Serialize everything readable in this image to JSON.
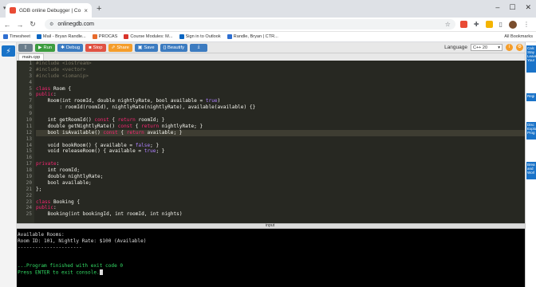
{
  "browser": {
    "tab_title": "GDB online Debugger | Compi...",
    "url": "onlinegdb.com",
    "bookmarks": [
      {
        "label": "Timesheet",
        "color": "#2f6fd1"
      },
      {
        "label": "Mail - Bryan Randle...",
        "color": "#0a66c2"
      },
      {
        "label": "PROCAS",
        "color": "#e86b2d"
      },
      {
        "label": "Course Modules: M...",
        "color": "#d9342b"
      },
      {
        "label": "Sign in to Outlook",
        "color": "#0a66c2"
      },
      {
        "label": "Randle, Bryan | CTR...",
        "color": "#2f6fd1"
      }
    ],
    "all_bookmarks": "All Bookmarks"
  },
  "toolbar": {
    "run": "Run",
    "debug": "Debug",
    "stop": "Stop",
    "share": "Share",
    "save": "Save",
    "beautify": "{} Beautify",
    "language_label": "Language",
    "language_value": "C++ 20"
  },
  "file_tab": "main.cpp",
  "editor": {
    "highlight_line": 12,
    "lines": [
      {
        "n": "1",
        "text": "#include <iostream>"
      },
      {
        "n": "2",
        "text": "#include <vector>"
      },
      {
        "n": "3",
        "text": "#include <iomanip>"
      },
      {
        "n": "4",
        "text": ""
      },
      {
        "n": "5",
        "text": "class Room {"
      },
      {
        "n": "6",
        "text": "public:"
      },
      {
        "n": "7",
        "text": "    Room(int roomId, double nightlyRate, bool available = true)"
      },
      {
        "n": "8",
        "text": "        : roomId(roomId), nightlyRate(nightlyRate), available(available) {}"
      },
      {
        "n": "9",
        "text": ""
      },
      {
        "n": "10",
        "text": "    int getRoomId() const { return roomId; }"
      },
      {
        "n": "11",
        "text": "    double getNightlyRate() const { return nightlyRate; }"
      },
      {
        "n": "12",
        "text": "    bool isAvailable() const { return available; }"
      },
      {
        "n": "13",
        "text": ""
      },
      {
        "n": "14",
        "text": "    void bookRoom() { available = false; }"
      },
      {
        "n": "15",
        "text": "    void releaseRoom() { available = true; }"
      },
      {
        "n": "16",
        "text": ""
      },
      {
        "n": "17",
        "text": "private:"
      },
      {
        "n": "18",
        "text": "    int roomId;"
      },
      {
        "n": "19",
        "text": "    double nightlyRate;"
      },
      {
        "n": "20",
        "text": "    bool available;"
      },
      {
        "n": "21",
        "text": "};"
      },
      {
        "n": "22",
        "text": ""
      },
      {
        "n": "23",
        "text": "class Booking {"
      },
      {
        "n": "24",
        "text": "public:"
      },
      {
        "n": "25",
        "text": "    Booking(int bookingId, int roomId, int nights)"
      }
    ]
  },
  "io_label": "input",
  "console": {
    "lines": [
      "Available Rooms:",
      "Room ID: 101, Nightly Rate: $100 (Available)",
      "----------------------",
      "",
      "",
      "...Program finished with exit code 0"
    ],
    "prompt": "Press ENTER to exit console."
  },
  "ads": [
    "Calc Stay Leave Your",
    "Regi",
    "Disc Explo Prog",
    "Brea and Worl"
  ]
}
